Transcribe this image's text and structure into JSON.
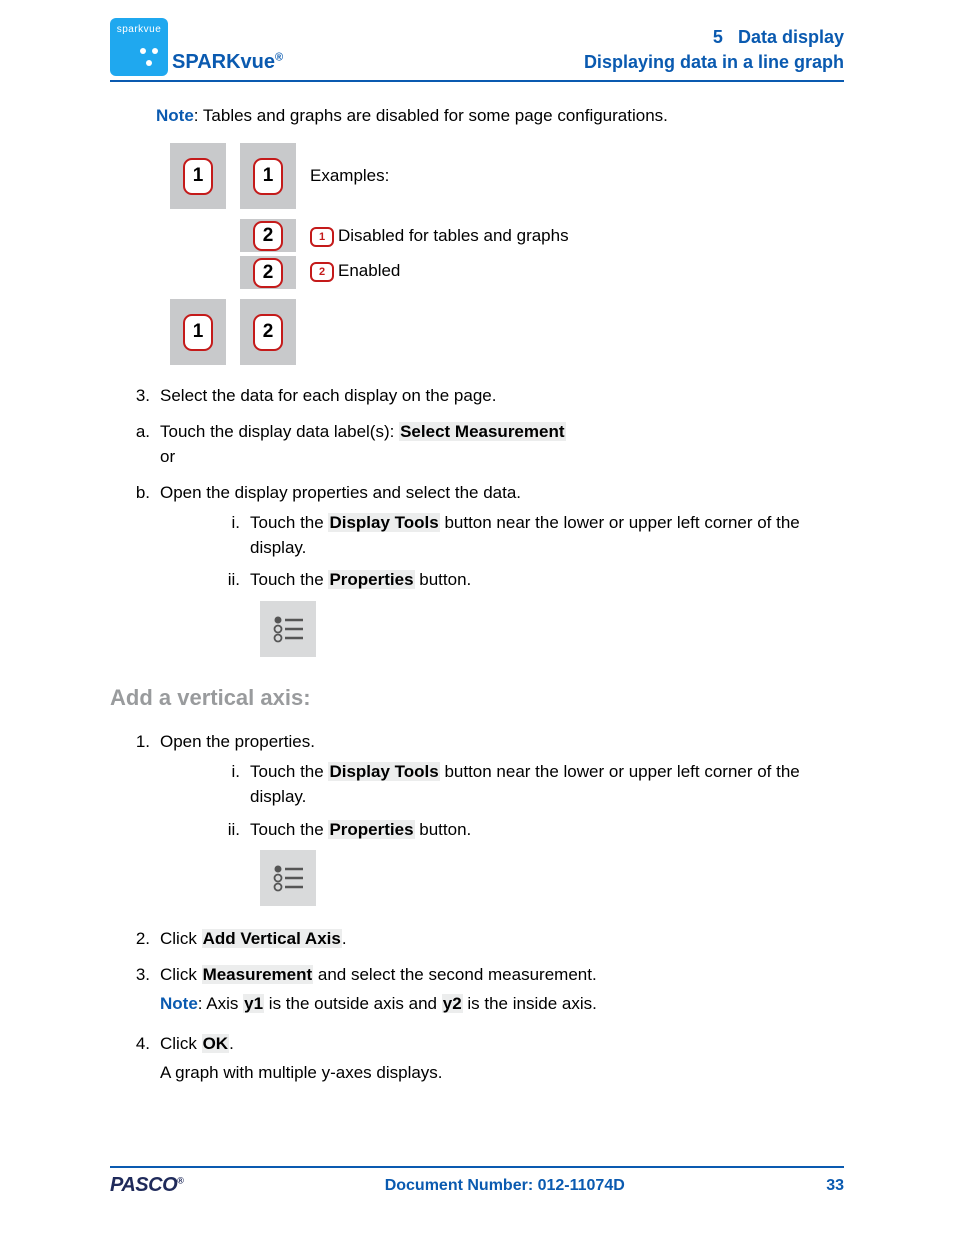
{
  "header": {
    "logo_text": "sparkvue",
    "product": "SPARKvue",
    "product_reg": "®",
    "section_number": "5",
    "section_title": "Data display",
    "subsection": "Displaying data in a line graph"
  },
  "note1": {
    "label": "Note",
    "text": ": Tables and graphs are disabled for some page configurations."
  },
  "figure": {
    "examples_label": "Examples:",
    "callout1_num": "1",
    "callout1_text": "Disabled for tables and graphs",
    "callout2_num": "2",
    "callout2_text": "Enabled",
    "badge1": "1",
    "badge2": "2"
  },
  "steps": {
    "s3_marker": "3.",
    "s3": "Select the data for each display on the page.",
    "a_marker": "a.",
    "a_pre": "Touch the display data label(s): ",
    "a_hl": "Select Measurement",
    "a_or": "or",
    "b_marker": "b.",
    "b": "Open the display properties and select the data.",
    "bi_marker": "i.",
    "bi_pre": "Touch the ",
    "bi_hl": "Display Tools",
    "bi_post": " button near the lower or upper left corner of the display.",
    "bii_marker": "ii.",
    "bii_pre": "Touch the ",
    "bii_hl": "Properties",
    "bii_post": " button."
  },
  "section2": {
    "heading": "Add a vertical axis:",
    "s1_marker": "1.",
    "s1": "Open the properties.",
    "s1i_marker": "i.",
    "s1i_pre": "Touch the ",
    "s1i_hl": "Display Tools",
    "s1i_post": " button near the lower or upper left corner of the display.",
    "s1ii_marker": "ii.",
    "s1ii_pre": "Touch the ",
    "s1ii_hl": "Properties",
    "s1ii_post": " button.",
    "s2_marker": "2.",
    "s2_pre": "Click ",
    "s2_hl": "Add Vertical Axis",
    "s2_post": ".",
    "s3_marker": "3.",
    "s3_pre": "Click ",
    "s3_hl": "Measurement",
    "s3_post": " and select the second measurement.",
    "s3_note_label": "Note",
    "s3_note_pre": ": Axis ",
    "s3_note_y1": "y1",
    "s3_note_mid": " is the outside axis and ",
    "s3_note_y2": "y2",
    "s3_note_post": " is the inside axis.",
    "s4_marker": "4.",
    "s4_pre": "Click ",
    "s4_hl": "OK",
    "s4_post": ".",
    "s4_result": "A graph with multiple y-axes displays."
  },
  "footer": {
    "brand": "PASCO",
    "doc_label": "Document Number: 012-11074D",
    "page": "33"
  }
}
